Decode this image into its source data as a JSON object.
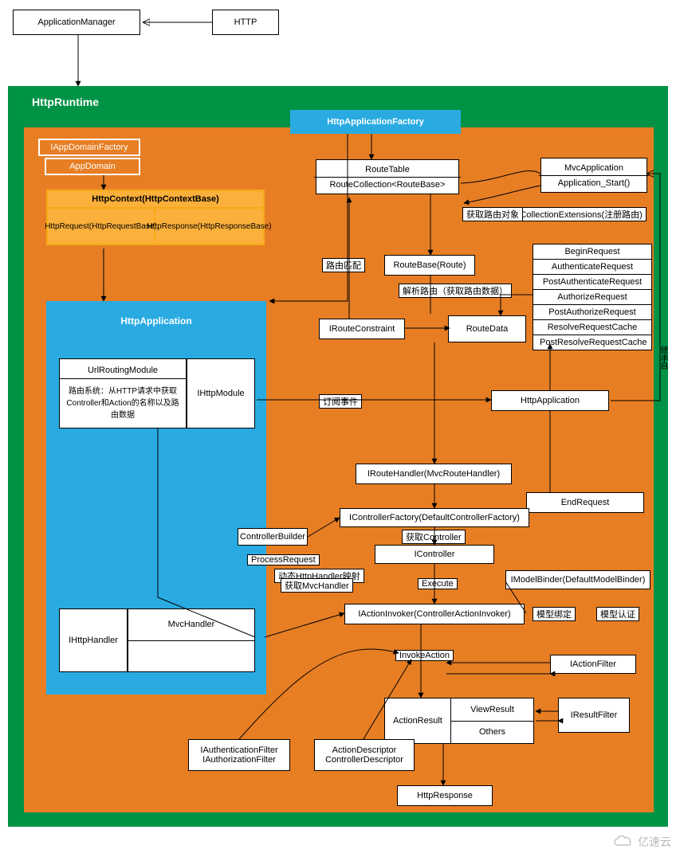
{
  "top": {
    "appManager": "ApplicationManager",
    "http": "HTTP"
  },
  "container": {
    "title": "HttpRuntime"
  },
  "factory": "HttpApplicationFactory",
  "appdomain": {
    "iappdomain": "IAppDomainFactory",
    "appdomain": "AppDomain"
  },
  "httpcontext": {
    "header": "HttpContext(HttpContextBase)",
    "request": "HttpRequest(HttpRequestBase)",
    "response": "HttpResponse(HttpResponseBase)"
  },
  "httpapplication": {
    "title": "HttpApplication"
  },
  "urlrouting": {
    "header": "UrlRoutingModule",
    "body": "路由系统：从HTTP请求中获取Controller和Action的名称以及路由数据",
    "ihttpmodule": "IHttpModule"
  },
  "mvchandler": {
    "ihttphandler": "IHttpHandler",
    "mvchandler": "MvcHandler"
  },
  "route": {
    "routeTableHeader": "RouteTable",
    "routeCollection": "RouteCollection<RouteBase>",
    "routeBase": "RouteBase(Route)",
    "irouteConstraint": "IRouteConstraint",
    "routeData": "RouteData",
    "irouteHandler": "IRouteHandler(MvcRouteHandler)"
  },
  "mvcapp": {
    "header": "MvcApplication",
    "appstart": "Application_Start()",
    "registerRoutes": "RouteCollectionExtensions(注册路由)"
  },
  "events": {
    "items": [
      "BeginRequest",
      "AuthenticateRequest",
      "PostAuthenticateRequest",
      "AuthorizeRequest",
      "PostAuthorizeRequest",
      "ResolveRequestCache",
      "PostResolveRequestCache"
    ],
    "httpapp": "HttpApplication",
    "end": "EndRequest",
    "inherit": "继承自"
  },
  "ctrl": {
    "factory": "IControllerFactory(DefaultControllerFactory)",
    "builder": "ControllerBuilder",
    "icontroller": "IController",
    "getCtrl": "获取Controller",
    "process": "ProcessRequest",
    "dynamic1": "动态HttpHandler映射",
    "dynamic2": "获取MvcHandler",
    "execute": "Execute"
  },
  "action": {
    "invoker": "IActionInvoker(ControllerActionInvoker)",
    "modelBinder": "IModelBinder(DefaultModelBinder)",
    "modelBind": "模型绑定",
    "modelValidate": "模型认证",
    "invokeAction": "InvokeAction",
    "actionFilter": "IActionFilter",
    "resultHeader": "ActionResult",
    "viewResult": "ViewResult",
    "others": "Others",
    "resultFilter": "IResultFilter",
    "authFilters1": "IAuthenticationFilter",
    "authFilters2": "IAuthorizationFilter",
    "descriptor1": "ActionDescriptor",
    "descriptor2": "ControllerDescriptor",
    "httpResponse": "HttpResponse"
  },
  "labels": {
    "routeMatch": "路由匹配",
    "getRouteObj": "获取路由对象",
    "parseRoute": "解析路由（获取路由数据）",
    "subscribe": "订阅事件"
  },
  "watermark": "亿速云"
}
